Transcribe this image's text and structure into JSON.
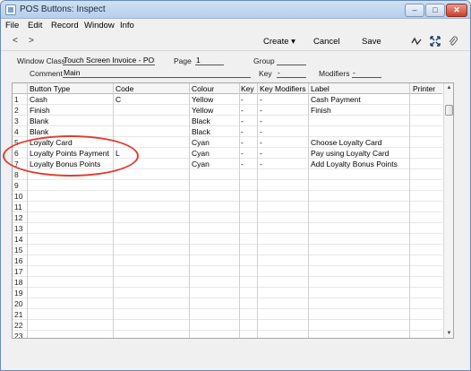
{
  "window": {
    "title": "POS Buttons: Inspect",
    "min_label": "–",
    "max_label": "□",
    "close_label": "✕"
  },
  "menu": {
    "items": [
      "File",
      "Edit",
      "Record",
      "Window",
      "Info"
    ]
  },
  "toolbar": {
    "back": "<",
    "forward": ">",
    "create_label": "Create ▾",
    "cancel_label": "Cancel",
    "save_label": "Save",
    "icons": [
      "chart-icon",
      "expand-icon",
      "paperclip-icon"
    ]
  },
  "header": {
    "window_class_label": "Window Class",
    "window_class_value": "Touch Screen Invoice - POS",
    "page_label": "Page",
    "page_value": "1",
    "group_label": "Group",
    "group_value": "",
    "comment_label": "Comment",
    "comment_value": "Main",
    "key_label": "Key",
    "key_value": "-",
    "modifiers_label": "Modifiers",
    "modifiers_value": "-"
  },
  "table": {
    "columns": [
      "Button Type",
      "Code",
      "Colour",
      "Key",
      "Key Modifiers",
      "Label",
      "Printer"
    ],
    "rows": [
      [
        "1",
        "Cash",
        "C",
        "Yellow",
        "-",
        "-",
        "Cash Payment",
        ""
      ],
      [
        "2",
        "Finish",
        "",
        "Yellow",
        "-",
        "-",
        "Finish",
        ""
      ],
      [
        "3",
        "Blank",
        "",
        "Black",
        "-",
        "-",
        "",
        ""
      ],
      [
        "4",
        "Blank",
        "",
        "Black",
        "-",
        "-",
        "",
        ""
      ],
      [
        "5",
        "Loyalty Card",
        "",
        "Cyan",
        "-",
        "-",
        "Choose Loyalty Card",
        ""
      ],
      [
        "6",
        "Loyalty Points Payment",
        "L",
        "Cyan",
        "-",
        "-",
        "Pay using Loyalty Card",
        ""
      ],
      [
        "7",
        "Loyalty Bonus Points",
        "",
        "Cyan",
        "-",
        "-",
        "Add Loyalty Bonus Points",
        ""
      ],
      [
        "8",
        "",
        "",
        "",
        "",
        "",
        "",
        ""
      ],
      [
        "9",
        "",
        "",
        "",
        "",
        "",
        "",
        ""
      ],
      [
        "10",
        "",
        "",
        "",
        "",
        "",
        "",
        ""
      ],
      [
        "11",
        "",
        "",
        "",
        "",
        "",
        "",
        ""
      ],
      [
        "12",
        "",
        "",
        "",
        "",
        "",
        "",
        ""
      ],
      [
        "13",
        "",
        "",
        "",
        "",
        "",
        "",
        ""
      ],
      [
        "14",
        "",
        "",
        "",
        "",
        "",
        "",
        ""
      ],
      [
        "15",
        "",
        "",
        "",
        "",
        "",
        "",
        ""
      ],
      [
        "16",
        "",
        "",
        "",
        "",
        "",
        "",
        ""
      ],
      [
        "17",
        "",
        "",
        "",
        "",
        "",
        "",
        ""
      ],
      [
        "18",
        "",
        "",
        "",
        "",
        "",
        "",
        ""
      ],
      [
        "19",
        "",
        "",
        "",
        "",
        "",
        "",
        ""
      ],
      [
        "20",
        "",
        "",
        "",
        "",
        "",
        "",
        ""
      ],
      [
        "21",
        "",
        "",
        "",
        "",
        "",
        "",
        ""
      ],
      [
        "22",
        "",
        "",
        "",
        "",
        "",
        "",
        ""
      ],
      [
        "23",
        "",
        "",
        "",
        "",
        "",
        "",
        ""
      ]
    ]
  },
  "scrollbar": {
    "up": "▲",
    "down": "▼"
  },
  "colors": {
    "annotation": "#e23b2f",
    "title_bar": "#b7cfea"
  }
}
